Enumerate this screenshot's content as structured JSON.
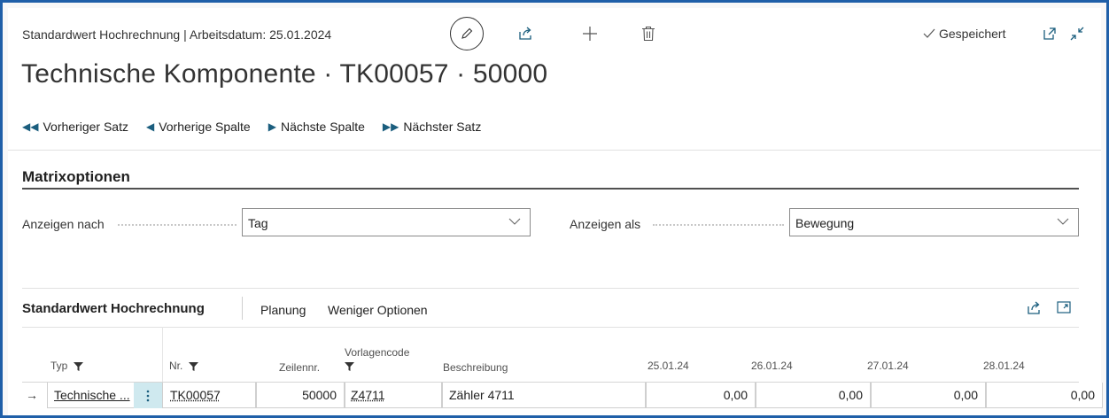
{
  "header": {
    "caption": "Standardwert Hochrechnung | Arbeitsdatum: 25.01.2024",
    "title": "Technische Komponente · TK00057 · 50000",
    "saved_label": "Gespeichert",
    "icons": [
      "edit-icon",
      "share-icon",
      "add-icon",
      "delete-icon",
      "open-new-window-icon",
      "collapse-icon"
    ],
    "accent_color": "#1b5e7e"
  },
  "actions": [
    {
      "label": "Vorheriger Satz",
      "icon": "double-left-icon"
    },
    {
      "label": "Vorherige Spalte",
      "icon": "left-icon"
    },
    {
      "label": "Nächste Spalte",
      "icon": "right-icon"
    },
    {
      "label": "Nächster Satz",
      "icon": "double-right-icon"
    }
  ],
  "matrix_options": {
    "title": "Matrixoptionen",
    "show_by_label": "Anzeigen nach",
    "show_by_value": "Tag",
    "show_as_label": "Anzeigen als",
    "show_as_value": "Bewegung"
  },
  "subpage": {
    "title": "Standardwert Hochrechnung",
    "planning_label": "Planung",
    "fewer_options_label": "Weniger Optionen",
    "columns": {
      "typ": "Typ",
      "nr": "Nr.",
      "zeilennr": "Zeilennr.",
      "vorlagencode": "Vorlagencode",
      "beschreibung": "Beschreibung",
      "d1": "25.01.24",
      "d2": "26.01.24",
      "d3": "27.01.24",
      "d4": "28.01.24"
    },
    "row": {
      "typ": "Technische ...",
      "nr": "TK00057",
      "zeilennr": "50000",
      "vorlagencode": "Z4711",
      "beschreibung": "Zähler 4711",
      "d1": "0,00",
      "d2": "0,00",
      "d3": "0,00",
      "d4": "0,00"
    }
  }
}
